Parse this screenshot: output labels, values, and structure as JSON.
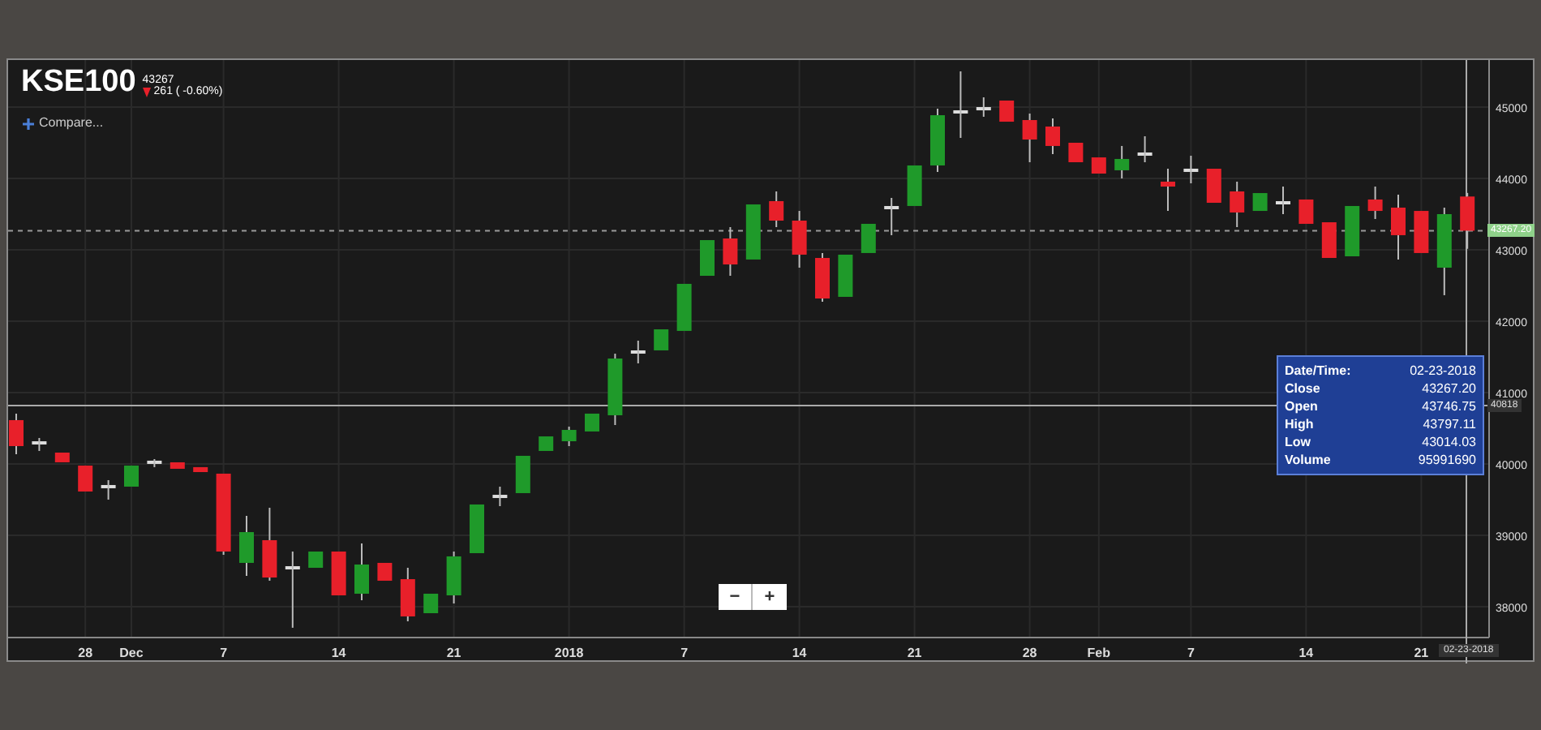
{
  "header": {
    "symbol": "KSE100",
    "last": "43267",
    "change": "261 ( -0.60%)"
  },
  "compare": {
    "label": "Compare..."
  },
  "chart_data": {
    "type": "candlestick",
    "categories": [
      null,
      null,
      null,
      "28",
      null,
      "Dec",
      null,
      null,
      null,
      "7",
      null,
      null,
      null,
      null,
      "14",
      null,
      null,
      null,
      null,
      "21",
      null,
      null,
      null,
      null,
      "2018",
      null,
      null,
      null,
      null,
      "7",
      null,
      null,
      null,
      null,
      "14",
      null,
      null,
      null,
      null,
      "21",
      null,
      null,
      null,
      null,
      "28",
      null,
      null,
      "Feb",
      null,
      null,
      null,
      "7",
      null,
      null,
      null,
      null,
      "14",
      null,
      null,
      null,
      null,
      "21",
      null,
      null
    ],
    "ylim": [
      37568,
      45659
    ],
    "ohlc": [
      [
        40614,
        40705,
        40136,
        40250
      ],
      [
        40295,
        40364,
        40182,
        40295
      ],
      [
        40159,
        40159,
        40023,
        40023
      ],
      [
        39977,
        39977,
        39614,
        39614
      ],
      [
        39682,
        39773,
        39500,
        39682
      ],
      [
        39682,
        39977,
        39682,
        39977
      ],
      [
        40023,
        40068,
        39955,
        40023
      ],
      [
        40023,
        40023,
        39932,
        39932
      ],
      [
        39955,
        39955,
        39886,
        39886
      ],
      [
        39864,
        39864,
        38727,
        38773
      ],
      [
        38614,
        39273,
        38432,
        39045
      ],
      [
        38932,
        39386,
        38364,
        38409
      ],
      [
        38545,
        38773,
        37705,
        38545
      ],
      [
        38545,
        38773,
        38545,
        38773
      ],
      [
        38773,
        38773,
        38159,
        38159
      ],
      [
        38182,
        38886,
        38091,
        38591
      ],
      [
        38614,
        38614,
        38364,
        38364
      ],
      [
        38386,
        38545,
        37795,
        37864
      ],
      [
        37909,
        38182,
        37909,
        38182
      ],
      [
        38159,
        38773,
        38045,
        38705
      ],
      [
        38750,
        39432,
        38750,
        39432
      ],
      [
        39545,
        39682,
        39409,
        39545
      ],
      [
        39591,
        40114,
        39591,
        40114
      ],
      [
        40182,
        40386,
        40182,
        40386
      ],
      [
        40318,
        40523,
        40250,
        40477
      ],
      [
        40455,
        40705,
        40455,
        40705
      ],
      [
        40682,
        41545,
        40545,
        41477
      ],
      [
        41568,
        41727,
        41409,
        41568
      ],
      [
        41591,
        41886,
        41591,
        41886
      ],
      [
        41864,
        42523,
        41864,
        42523
      ],
      [
        42636,
        43136,
        42636,
        43136
      ],
      [
        43159,
        43318,
        42636,
        42795
      ],
      [
        42864,
        43636,
        42864,
        43636
      ],
      [
        43682,
        43818,
        43318,
        43409
      ],
      [
        43409,
        43545,
        42750,
        42932
      ],
      [
        42886,
        42955,
        42273,
        42318
      ],
      [
        42341,
        42932,
        42341,
        42932
      ],
      [
        42955,
        43364,
        42955,
        43364
      ],
      [
        43591,
        43727,
        43205,
        43591
      ],
      [
        43614,
        44182,
        43614,
        44182
      ],
      [
        44182,
        44977,
        44091,
        44886
      ],
      [
        44932,
        45500,
        44568,
        44932
      ],
      [
        44977,
        45136,
        44864,
        44977
      ],
      [
        45091,
        45091,
        44795,
        44795
      ],
      [
        44818,
        44909,
        44227,
        44545
      ],
      [
        44727,
        44841,
        44341,
        44455
      ],
      [
        44500,
        44500,
        44227,
        44227
      ],
      [
        44295,
        44295,
        44068,
        44068
      ],
      [
        44114,
        44455,
        44000,
        44273
      ],
      [
        44341,
        44591,
        44227,
        44341
      ],
      [
        43955,
        44136,
        43545,
        43886
      ],
      [
        44114,
        44318,
        43932,
        44114
      ],
      [
        44136,
        44136,
        43659,
        43659
      ],
      [
        43818,
        43955,
        43318,
        43523
      ],
      [
        43545,
        43795,
        43545,
        43795
      ],
      [
        43659,
        43886,
        43500,
        43659
      ],
      [
        43705,
        43705,
        43364,
        43364
      ],
      [
        43386,
        43386,
        42886,
        42886
      ],
      [
        42909,
        43614,
        42909,
        43614
      ],
      [
        43705,
        43886,
        43432,
        43545
      ],
      [
        43591,
        43773,
        42864,
        43205
      ],
      [
        43545,
        43545,
        42955,
        42955
      ],
      [
        42750,
        43591,
        42364,
        43500
      ],
      [
        43746.75,
        43797.11,
        43014.03,
        43267.2
      ]
    ],
    "yticks": [
      45000,
      44000,
      43000,
      42000,
      41000,
      40000,
      39000,
      38000
    ],
    "grid": true,
    "ref_lines": [
      {
        "axis": "y",
        "value": 43267.2
      },
      {
        "axis": "y",
        "value": 40818
      }
    ]
  },
  "last_price_tag": "43267.20",
  "crosshair": {
    "price": "40818",
    "date": "02-23-2018"
  },
  "tooltip": {
    "rows": [
      {
        "label": "Date/Time:",
        "value": "02-23-2018"
      },
      {
        "label": "Close",
        "value": "43267.20"
      },
      {
        "label": "Open",
        "value": "43746.75"
      },
      {
        "label": "High",
        "value": "43797.11"
      },
      {
        "label": "Low",
        "value": "43014.03"
      },
      {
        "label": "Volume",
        "value": "95991690"
      }
    ]
  },
  "zoom": {
    "out": "−",
    "in": "+"
  }
}
